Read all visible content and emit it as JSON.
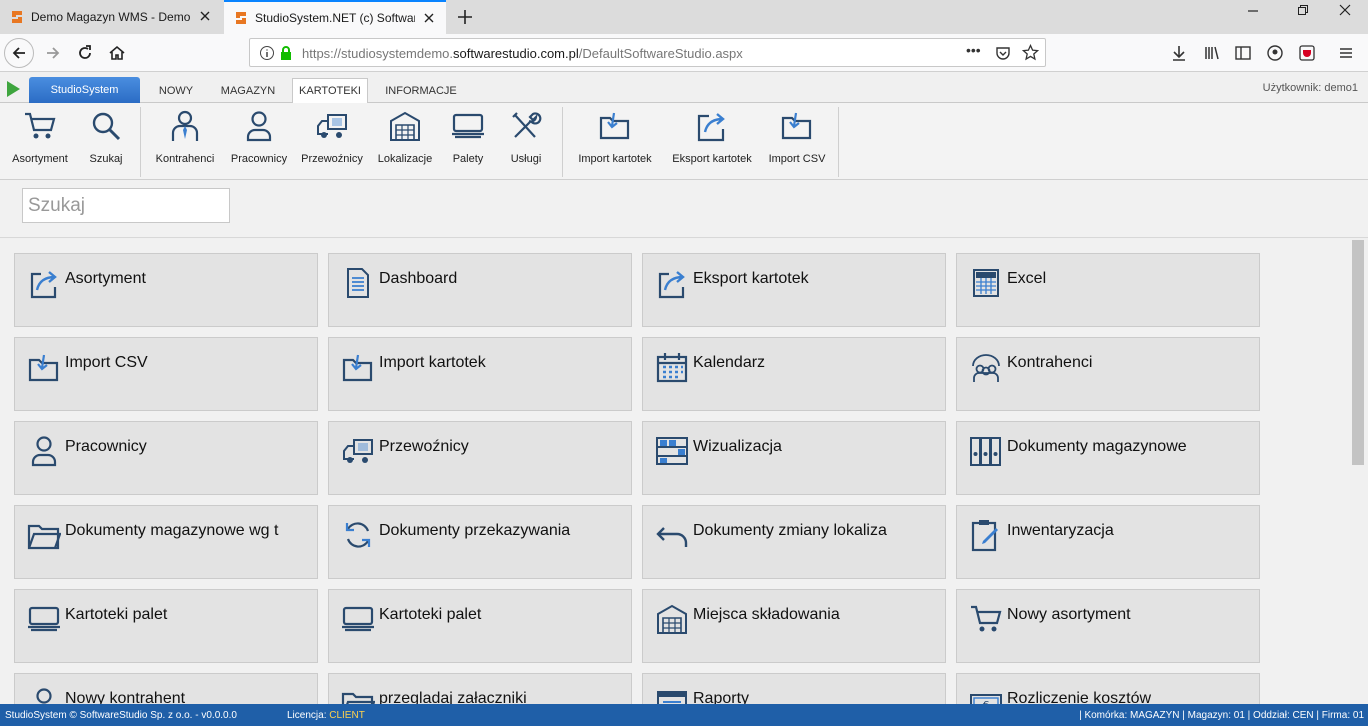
{
  "browser": {
    "tabs": [
      {
        "title": "Demo Magazyn WMS - Demo online"
      },
      {
        "title": "StudioSystem.NET (c) SoftwareStudio"
      }
    ],
    "url_prefix": "https://studiosystemdemo.",
    "url_domain": "softwarestudio.com.pl",
    "url_suffix": "/DefaultSoftwareStudio.aspx",
    "url_more": "•••"
  },
  "appmenu": {
    "brand": "StudioSystem",
    "tabs": [
      "NOWY",
      "MAGAZYN",
      "KARTOTEKI",
      "INFORMACJE"
    ],
    "active_tab": "KARTOTEKI",
    "user": "Użytkownik: demo1"
  },
  "ribbon": {
    "buttons": [
      {
        "label": "Asortyment",
        "icon": "cart-icon"
      },
      {
        "label": "Szukaj",
        "icon": "search-icon"
      },
      {
        "label": "Kontrahenci",
        "icon": "contractor-icon"
      },
      {
        "label": "Pracownicy",
        "icon": "person-icon"
      },
      {
        "label": "Przewoźnicy",
        "icon": "truck-icon"
      },
      {
        "label": "Lokalizacje",
        "icon": "warehouse-icon"
      },
      {
        "label": "Palety",
        "icon": "pallet-icon"
      },
      {
        "label": "Usługi",
        "icon": "tools-icon"
      },
      {
        "label": "Import kartotek",
        "icon": "import-folder-icon"
      },
      {
        "label": "Eksport kartotek",
        "icon": "export-icon"
      },
      {
        "label": "Import CSV",
        "icon": "import-folder-icon"
      }
    ]
  },
  "search": {
    "placeholder": "Szukaj"
  },
  "tiles": [
    {
      "label": "Asortyment",
      "icon": "export-arrow-icon"
    },
    {
      "label": "Dashboard",
      "icon": "document-icon"
    },
    {
      "label": "Eksport kartotek",
      "icon": "export-arrow-icon"
    },
    {
      "label": "Excel",
      "icon": "xls-icon"
    },
    {
      "label": "Import CSV",
      "icon": "import-folder-icon"
    },
    {
      "label": "Import kartotek",
      "icon": "import-folder-icon"
    },
    {
      "label": "Kalendarz",
      "icon": "calendar-icon"
    },
    {
      "label": "Kontrahenci",
      "icon": "group-icon"
    },
    {
      "label": "Pracownicy",
      "icon": "person-icon"
    },
    {
      "label": "Przewoźnicy",
      "icon": "truck-icon"
    },
    {
      "label": "Wizualizacja",
      "icon": "shelves-icon"
    },
    {
      "label": "Dokumenty magazynowe",
      "icon": "binders-icon"
    },
    {
      "label": "Dokumenty magazynowe wg t",
      "icon": "folder-icon"
    },
    {
      "label": "Dokumenty przekazywania",
      "icon": "refresh-icon"
    },
    {
      "label": "Dokumenty zmiany lokaliza",
      "icon": "undo-icon"
    },
    {
      "label": "Inwentaryzacja",
      "icon": "clipboard-icon"
    },
    {
      "label": "Kartoteki palet",
      "icon": "pallet-icon"
    },
    {
      "label": "Kartoteki palet",
      "icon": "pallet-icon"
    },
    {
      "label": "Miejsca składowania",
      "icon": "warehouse-icon"
    },
    {
      "label": "Nowy asortyment",
      "icon": "cart-icon"
    },
    {
      "label": "Nowy kontrahent",
      "icon": "person-icon"
    },
    {
      "label": "przegladaj załaczniki",
      "icon": "folder-icon"
    },
    {
      "label": "Raporty",
      "icon": "report-icon"
    },
    {
      "label": "Rozliczenie kosztów",
      "icon": "money-icon"
    }
  ],
  "statusbar": {
    "left": "StudioSystem © SoftwareStudio Sp. z o.o. - v0.0.0.0",
    "license_label": "Licencja:",
    "license_value": "CLIENT",
    "right": "| Komórka: MAGAZYN | Magazyn: 01 | Oddział: CEN | Firma: 01"
  },
  "colors": {
    "accent": "#2b6cc4",
    "statusbar": "#1f5fa8",
    "icon": "#2a4a6e"
  }
}
